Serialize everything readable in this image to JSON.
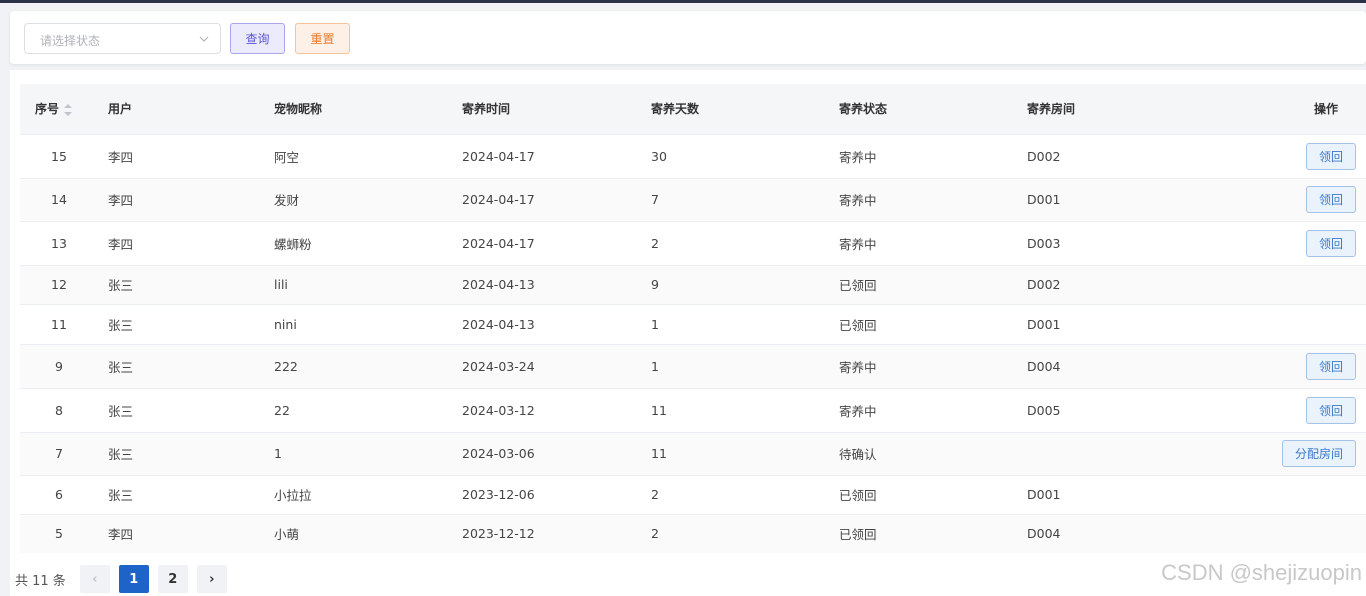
{
  "filter": {
    "status_placeholder": "请选择状态",
    "query_label": "查询",
    "reset_label": "重置"
  },
  "table": {
    "headers": {
      "index": "序号",
      "user": "用户",
      "pet": "宠物昵称",
      "time": "寄养时间",
      "days": "寄养天数",
      "status": "寄养状态",
      "room": "寄养房间",
      "op": "操作"
    },
    "rows": [
      {
        "index": "15",
        "user": "李四",
        "pet": "阿空",
        "time": "2024-04-17",
        "days": "30",
        "status": "寄养中",
        "room": "D002",
        "action": "领回"
      },
      {
        "index": "14",
        "user": "李四",
        "pet": "发财",
        "time": "2024-04-17",
        "days": "7",
        "status": "寄养中",
        "room": "D001",
        "action": "领回"
      },
      {
        "index": "13",
        "user": "李四",
        "pet": "螺蛳粉",
        "time": "2024-04-17",
        "days": "2",
        "status": "寄养中",
        "room": "D003",
        "action": "领回"
      },
      {
        "index": "12",
        "user": "张三",
        "pet": "lili",
        "time": "2024-04-13",
        "days": "9",
        "status": "已领回",
        "room": "D002",
        "action": ""
      },
      {
        "index": "11",
        "user": "张三",
        "pet": "nini",
        "time": "2024-04-13",
        "days": "1",
        "status": "已领回",
        "room": "D001",
        "action": ""
      },
      {
        "index": "9",
        "user": "张三",
        "pet": "222",
        "time": "2024-03-24",
        "days": "1",
        "status": "寄养中",
        "room": "D004",
        "action": "领回"
      },
      {
        "index": "8",
        "user": "张三",
        "pet": "22",
        "time": "2024-03-12",
        "days": "11",
        "status": "寄养中",
        "room": "D005",
        "action": "领回"
      },
      {
        "index": "7",
        "user": "张三",
        "pet": "1",
        "time": "2024-03-06",
        "days": "11",
        "status": "待确认",
        "room": "",
        "action": "分配房间"
      },
      {
        "index": "6",
        "user": "张三",
        "pet": "小拉拉",
        "time": "2023-12-06",
        "days": "2",
        "status": "已领回",
        "room": "D001",
        "action": ""
      },
      {
        "index": "5",
        "user": "李四",
        "pet": "小萌",
        "time": "2023-12-12",
        "days": "2",
        "status": "已领回",
        "room": "D004",
        "action": ""
      }
    ]
  },
  "pagination": {
    "total_text": "共 11 条",
    "prev": "‹",
    "next": "›",
    "pages": [
      "1",
      "2"
    ]
  },
  "watermark": "CSDN @shejizuopin"
}
